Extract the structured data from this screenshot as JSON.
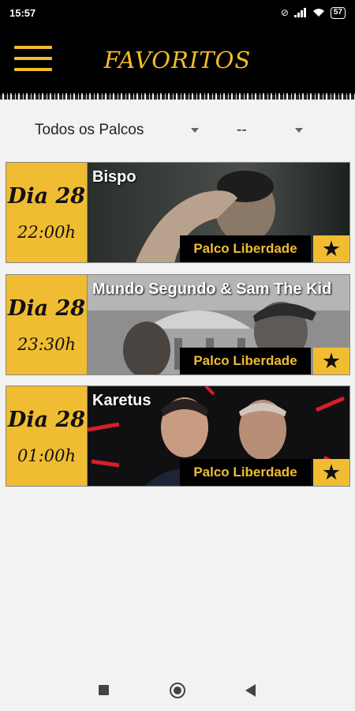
{
  "status_bar": {
    "time": "15:57",
    "battery": "57"
  },
  "header": {
    "title": "FAVORITOS"
  },
  "filters": {
    "stage": "Todos os Palcos",
    "day": "--"
  },
  "colors": {
    "accent": "#f0bc31",
    "header_bg": "#000000"
  },
  "events": [
    {
      "name": "Bispo",
      "day": "Dia 28",
      "time": "22:00h",
      "stage": "Palco Liberdade",
      "favorite_icon": "star-icon"
    },
    {
      "name": "Mundo Segundo & Sam The Kid",
      "day": "Dia 28",
      "time": "23:30h",
      "stage": "Palco Liberdade",
      "favorite_icon": "star-icon"
    },
    {
      "name": "Karetus",
      "day": "Dia 28",
      "time": "01:00h",
      "stage": "Palco Liberdade",
      "favorite_icon": "star-icon"
    }
  ]
}
